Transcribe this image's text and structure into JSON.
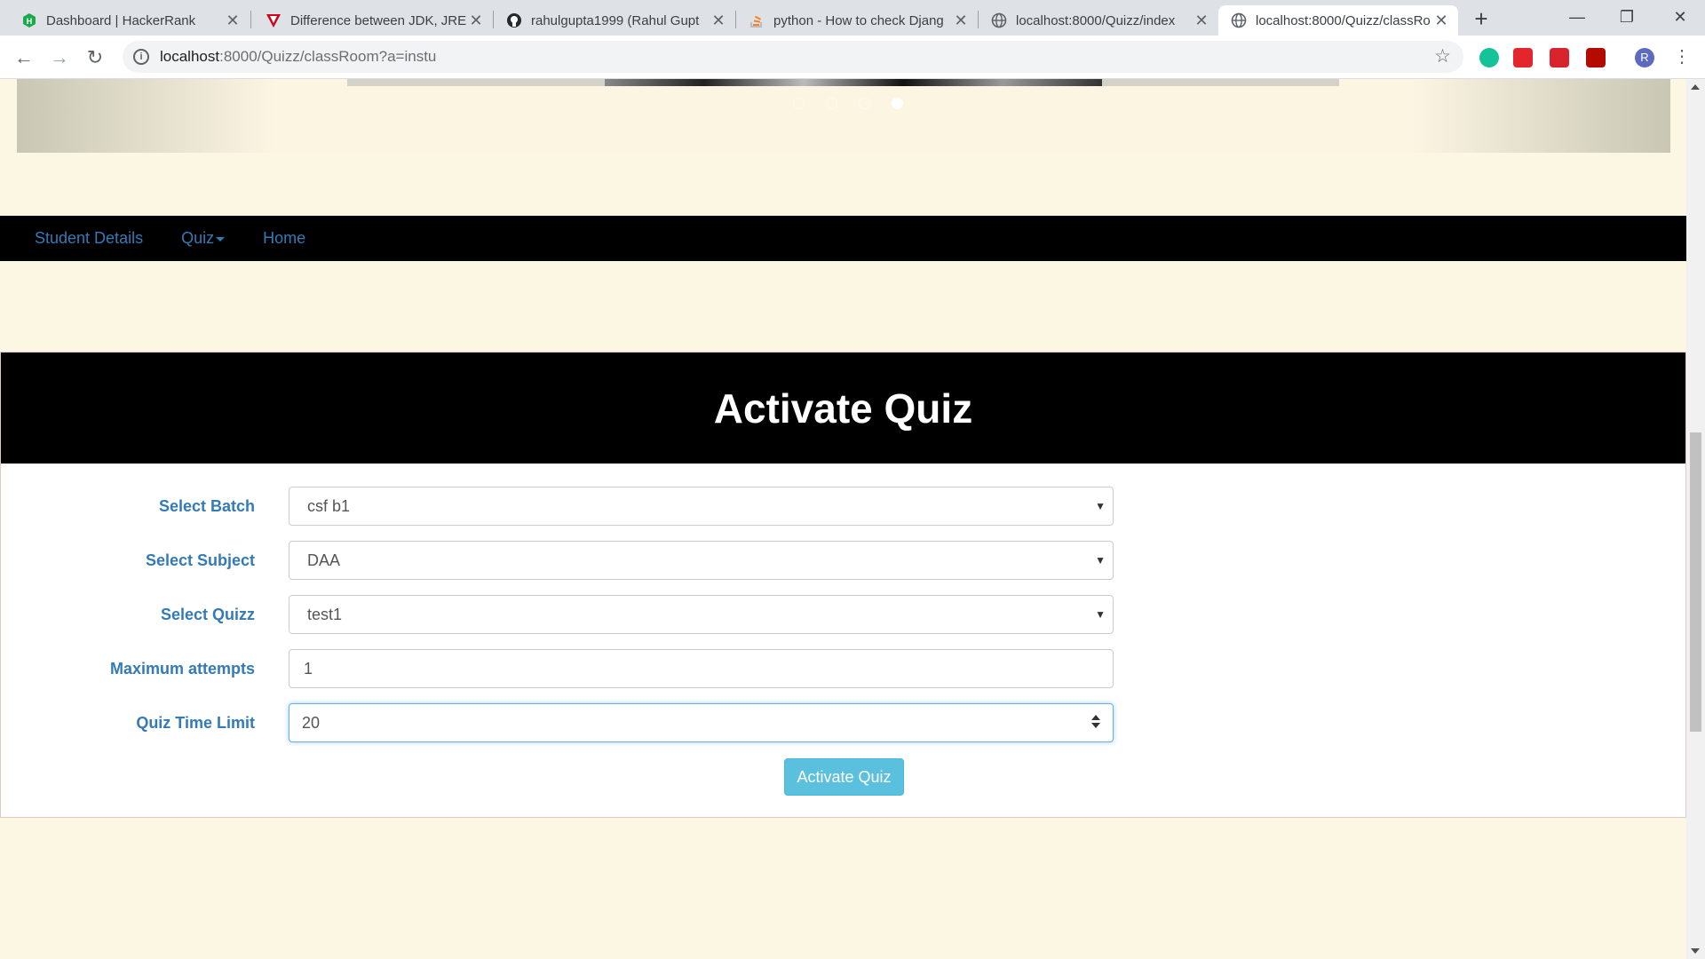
{
  "browser": {
    "tabs": [
      {
        "label": "Dashboard | HackerRank",
        "icon": "hackerrank-icon",
        "active": false
      },
      {
        "label": "Difference between JDK, JRE",
        "icon": "vivaldi-icon",
        "active": false
      },
      {
        "label": "rahulgupta1999 (Rahul Gupt",
        "icon": "github-icon",
        "active": false
      },
      {
        "label": "python - How to check Djang",
        "icon": "stackoverflow-icon",
        "active": false
      },
      {
        "label": "localhost:8000/Quizz/index",
        "icon": "globe-icon",
        "active": false
      },
      {
        "label": "localhost:8000/Quizz/classRo",
        "icon": "globe-icon",
        "active": true
      }
    ],
    "close_glyph": "✕",
    "new_tab": "+",
    "url_host": "localhost",
    "url_rest": ":8000/Quizz/classRoom?a=instu",
    "profile_initial": "R"
  },
  "nav": {
    "items": [
      "Student Details",
      "Quiz",
      "Home"
    ]
  },
  "carousel": {
    "slide_count": 4,
    "active_index": 3
  },
  "form": {
    "title": "Activate Quiz",
    "batch_label": "Select Batch",
    "batch_value": "csf b1",
    "subject_label": "Select Subject",
    "subject_value": "DAA",
    "quiz_label": "Select Quizz",
    "quiz_value": "test1",
    "attempts_label": "Maximum attempts",
    "attempts_value": "1",
    "time_label": "Quiz Time Limit",
    "time_value": "20",
    "submit_label": "Activate Quiz"
  },
  "colors": {
    "page_bg": "#fcf7e3",
    "label": "#337ab7",
    "button": "#5bc0de",
    "header": "#000000"
  }
}
